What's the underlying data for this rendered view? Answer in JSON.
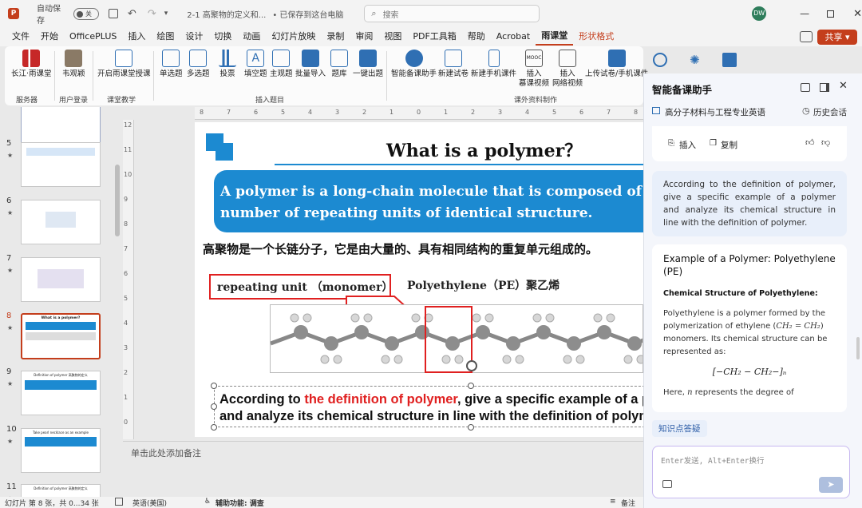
{
  "titlebar": {
    "autosave": "自动保存",
    "autosave_state": "关",
    "doc_title": "2-1 高聚物的定义和...",
    "saved_state": "• 已保存到这台电脑",
    "search_placeholder": "搜索",
    "user_initials": "DW"
  },
  "menu": {
    "tabs": [
      "文件",
      "开始",
      "OfficePLUS",
      "插入",
      "绘图",
      "设计",
      "切换",
      "动画",
      "幻灯片放映",
      "录制",
      "审阅",
      "视图",
      "PDF工具箱",
      "帮助",
      "Acrobat",
      "雨课堂",
      "形状格式"
    ],
    "share": "共享"
  },
  "ribbon": {
    "b1": "长江·雨课堂",
    "b2": "韦观颖",
    "b3": "开启雨课堂授课",
    "b4": "单选题",
    "b5": "多选题",
    "b6": "投票",
    "b7": "填空题",
    "b8": "主观题",
    "b9": "批量导入",
    "b10": "题库",
    "b11": "一键出题",
    "b12": "智能备课助手",
    "b13": "新建试卷",
    "b14": "新建手机课件",
    "b15a": "插入",
    "b15b": "慕课视频",
    "b16a": "插入",
    "b16b": "网络视频",
    "b17": "上传试卷/手机课件",
    "g1": "服务器",
    "g2": "用户登录",
    "g3": "课堂教学",
    "g4": "插入题目",
    "g5": "课外资料制作"
  },
  "thumbnails": {
    "n5": "5",
    "n6": "6",
    "n7": "7",
    "n8": "8",
    "n9": "9",
    "n10": "10",
    "n11": "11",
    "t8": "What is a polymer?",
    "t9": "Definition of polymer 高聚物的定义",
    "t10": "Take pearl necklace as an example",
    "t11": "Definition of polymer 高聚物的定义"
  },
  "slide": {
    "title": "What  is a polymer？",
    "def_line1": "A polymer is a long-chain molecule that is composed of a large",
    "def_line2": "number of repeating units of identical structure.",
    "chinese": "高聚物是一个长链分子，它是由大量的、具有相同结构的重复单元组成的。",
    "callout": "repeating unit （monomer）",
    "pe_label": "Polyethylene（PE）聚乙烯",
    "q_pre": "According to ",
    "q_red": "the definition of polymer",
    "q_post": ", give a specific example of a polymer",
    "q_line2": "and analyze its chemical structure in line with the definition of polymer."
  },
  "ruler": {
    "h": [
      "8",
      "7",
      "6",
      "5",
      "4",
      "3",
      "2",
      "1",
      "0",
      "1",
      "2",
      "3",
      "4",
      "5",
      "6",
      "7",
      "8"
    ],
    "v": [
      "12",
      "11",
      "10",
      "9",
      "8",
      "7",
      "6",
      "5",
      "4",
      "3",
      "2",
      "1",
      "0"
    ]
  },
  "notes": {
    "placeholder": "单击此处添加备注"
  },
  "status": {
    "slide_count": "幻灯片 第 8 张，共 0...34 张",
    "language": "英语(美国)",
    "accessibility": "辅助功能: 调查",
    "notes_btn": "备注"
  },
  "assistant": {
    "title": "智能备课助手",
    "course": "高分子材料与工程专业英语",
    "history": "历史会话",
    "insert": "插入",
    "copy": "复制",
    "user_msg": "According to the definition of polymer, give a specific example of a polymer and analyze its chemical structure in line with the definition of polymer.",
    "answer_title": "Example of a Polymer: Polyethylene (PE)",
    "answer_sub": "Chemical Structure of Polyethylene:",
    "answer_p1a": "Polyethylene is a polymer formed by the polymerization of ethylene (",
    "formula_inline": "CH₂ = CH₂",
    "answer_p1b": ") monomers. Its chemical structure can be represented as:",
    "formula": "[−CH₂ − CH₂−]ₙ",
    "answer_p2a": "Here, ",
    "answer_p2n": "n",
    "answer_p2b": " represents the degree of",
    "chip": "知识点答疑",
    "input_placeholder": "Enter发送, Alt+Enter换行"
  },
  "colors": {
    "brand": "#c43e1c",
    "slide_blue": "#1c8ad1",
    "callout_red": "#e02020",
    "assistant_bg": "#f4f6fb",
    "user_bubble": "#e8effa"
  }
}
